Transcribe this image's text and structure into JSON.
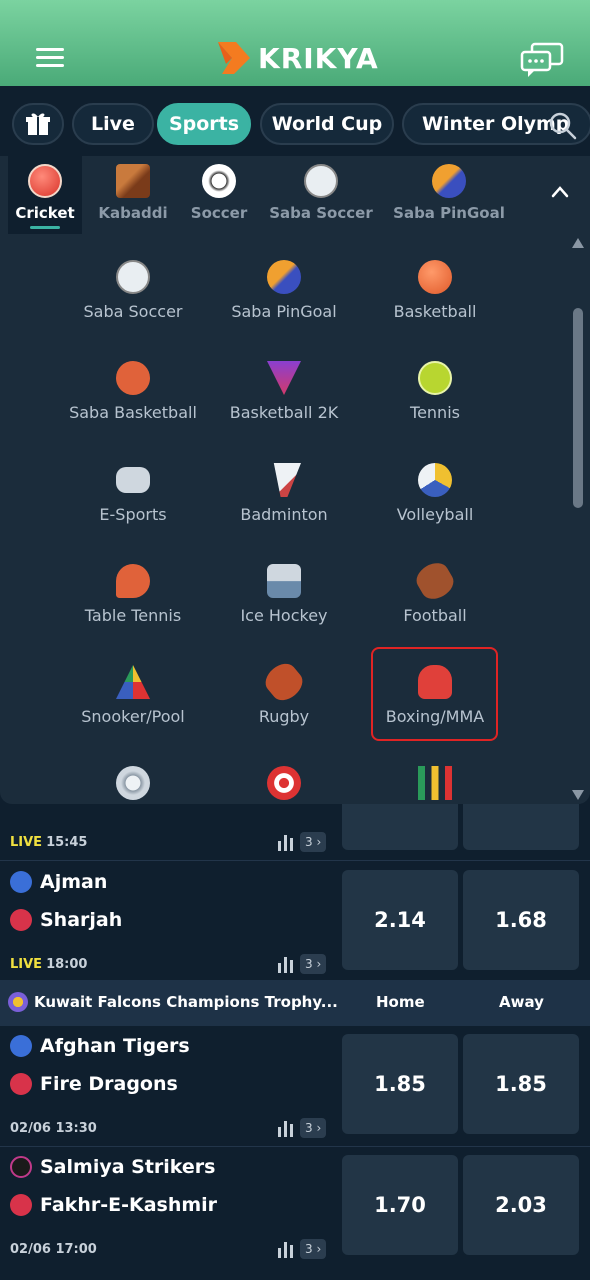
{
  "header": {
    "brand": "KRIKYA",
    "menu_icon": "hamburger-menu-icon",
    "chat_icon": "chat-bubbles-icon",
    "colors": {
      "gradient_top": "#7bd3a0",
      "gradient_bottom": "#4aaa78",
      "accent": "#3bb3a3"
    }
  },
  "tabs": [
    {
      "label": "Live"
    },
    {
      "label": "Sports",
      "active": true
    },
    {
      "label": "World Cup"
    },
    {
      "label": "Winter Olymp"
    }
  ],
  "categories": [
    {
      "label": "Cricket",
      "active": true,
      "icon": "cricket-ball-icon"
    },
    {
      "label": "Kabaddi",
      "icon": "kabaddi-icon"
    },
    {
      "label": "Soccer",
      "icon": "soccer-ball-icon"
    },
    {
      "label": "Saba Soccer",
      "icon": "saba-soccer-icon"
    },
    {
      "label": "Saba PinGoal",
      "icon": "saba-pingoal-icon"
    }
  ],
  "dropdown": {
    "items": [
      {
        "label": "Saba Soccer",
        "icon": "saba-soccer-icon"
      },
      {
        "label": "Saba PinGoal",
        "icon": "saba-pingoal-icon"
      },
      {
        "label": "Basketball",
        "icon": "basketball-icon"
      },
      {
        "label": "Saba Basketball",
        "icon": "saba-basketball-icon"
      },
      {
        "label": "Basketball 2K",
        "icon": "basketball-2k-icon"
      },
      {
        "label": "Tennis",
        "icon": "tennis-ball-icon"
      },
      {
        "label": "E-Sports",
        "icon": "gamepad-icon"
      },
      {
        "label": "Badminton",
        "icon": "shuttlecock-icon"
      },
      {
        "label": "Volleyball",
        "icon": "volleyball-icon"
      },
      {
        "label": "Table Tennis",
        "icon": "ping-pong-icon"
      },
      {
        "label": "Ice Hockey",
        "icon": "ice-hockey-icon"
      },
      {
        "label": "Football",
        "icon": "american-football-icon"
      },
      {
        "label": "Snooker/Pool",
        "icon": "pool-balls-icon"
      },
      {
        "label": "Rugby",
        "icon": "rugby-ball-icon"
      },
      {
        "label": "Boxing/MMA",
        "icon": "boxing-glove-icon",
        "highlighted": true
      },
      {
        "label": "",
        "icon": "futsal-ball-icon"
      },
      {
        "label": "",
        "icon": "darts-target-icon"
      },
      {
        "label": "",
        "icon": "financial-chart-icon"
      }
    ]
  },
  "matches_top": [
    {
      "time": "15:45",
      "live_label": "LIVE",
      "market_count": "3"
    },
    {
      "home": "Ajman",
      "away": "Sharjah",
      "live_label": "LIVE",
      "time": "18:00",
      "market_count": "3",
      "odds": [
        "2.14",
        "1.68"
      ]
    }
  ],
  "league": {
    "name": "Kuwait Falcons Champions Trophy...",
    "home_header": "Home",
    "away_header": "Away"
  },
  "matches_bottom": [
    {
      "home": "Afghan Tigers",
      "away": "Fire Dragons",
      "time": "02/06 13:30",
      "market_count": "3",
      "odds": [
        "1.85",
        "1.85"
      ]
    },
    {
      "home": "Salmiya Strikers",
      "away": "Fakhr-E-Kashmir",
      "time": "02/06 17:00",
      "market_count": "3",
      "odds": [
        "1.70",
        "2.03"
      ]
    }
  ]
}
